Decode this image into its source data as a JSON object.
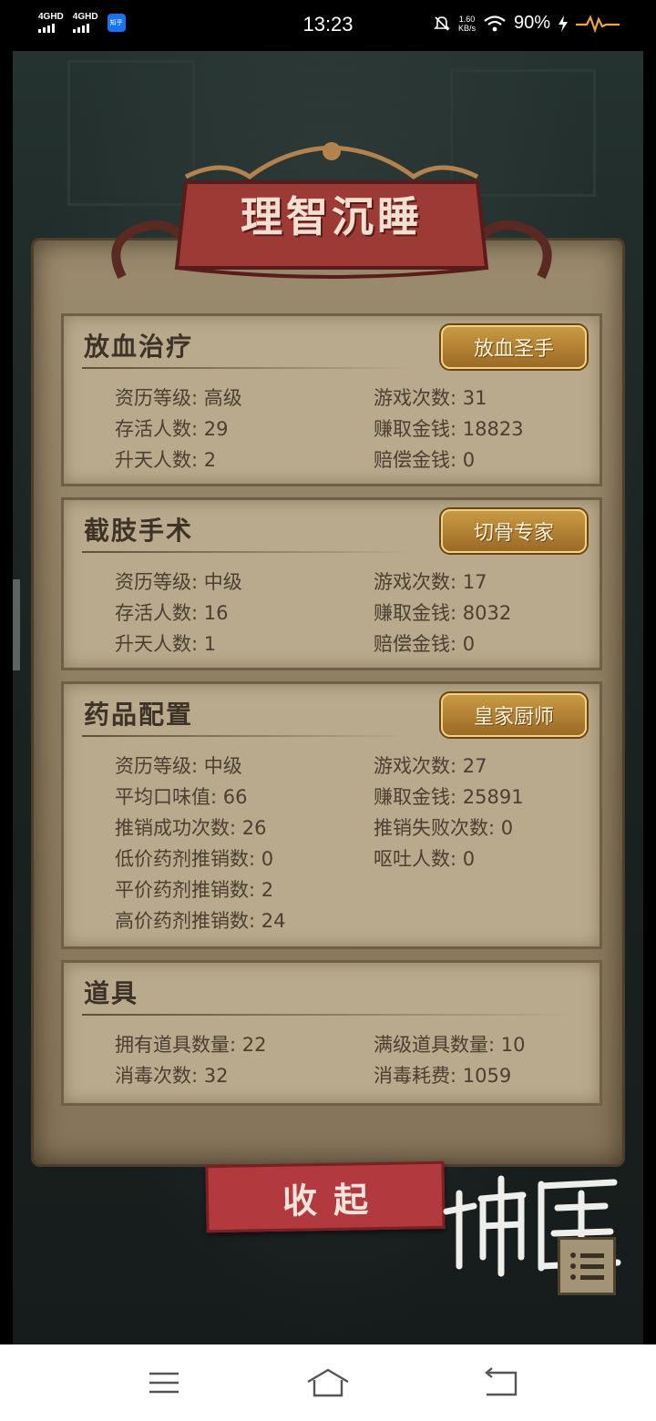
{
  "status_bar": {
    "signal_1": "4GHD",
    "signal_2": "4GHD",
    "app_badge": "知乎",
    "time": "13:23",
    "net_speed_value": "1.60",
    "net_speed_unit": "KB/s",
    "battery": "90%"
  },
  "banner": {
    "title": "理智沉睡"
  },
  "sections": {
    "bloodletting": {
      "title": "放血治疗",
      "badge": "放血圣手",
      "stats": {
        "qualification": "资历等级: 高级",
        "games": "游戏次数: 31",
        "survivors": "存活人数: 29",
        "earned": "赚取金钱: 18823",
        "ascended": "升天人数: 2",
        "compensation": "赔偿金钱: 0"
      }
    },
    "amputation": {
      "title": "截肢手术",
      "badge": "切骨专家",
      "stats": {
        "qualification": "资历等级: 中级",
        "games": "游戏次数: 17",
        "survivors": "存活人数: 16",
        "earned": "赚取金钱: 8032",
        "ascended": "升天人数: 1",
        "compensation": "赔偿金钱: 0"
      }
    },
    "medicine": {
      "title": "药品配置",
      "badge": "皇家厨师",
      "stats": {
        "qualification": "资历等级: 中级",
        "games": "游戏次数: 27",
        "avg_taste": "平均口味值: 66",
        "earned": "赚取金钱: 25891",
        "promo_success": "推销成功次数: 26",
        "promo_fail": "推销失败次数: 0",
        "low_price": "低价药剂推销数: 0",
        "vomit": "呕吐人数: 0",
        "mid_price": "平价药剂推销数: 2",
        "high_price": "高价药剂推销数: 24"
      }
    },
    "items": {
      "title": "道具",
      "stats": {
        "owned": "拥有道具数量: 22",
        "maxed": "满级道具数量: 10",
        "disinfect_count": "消毒次数: 32",
        "disinfect_cost": "消毒耗费: 1059"
      }
    }
  },
  "collapse_button": {
    "label": "收起"
  },
  "logo_text": "神医",
  "colors": {
    "parchment": "#b9aa8d",
    "banner_red": "#9c3b36",
    "badge_gold": "#c99a44",
    "button_red": "#b23a3e",
    "text_dark": "#4a3f31"
  },
  "icons": {
    "menu": "list-menu-icon",
    "nav_menu": "hamburger-icon",
    "nav_home": "home-icon",
    "nav_back": "back-icon"
  }
}
